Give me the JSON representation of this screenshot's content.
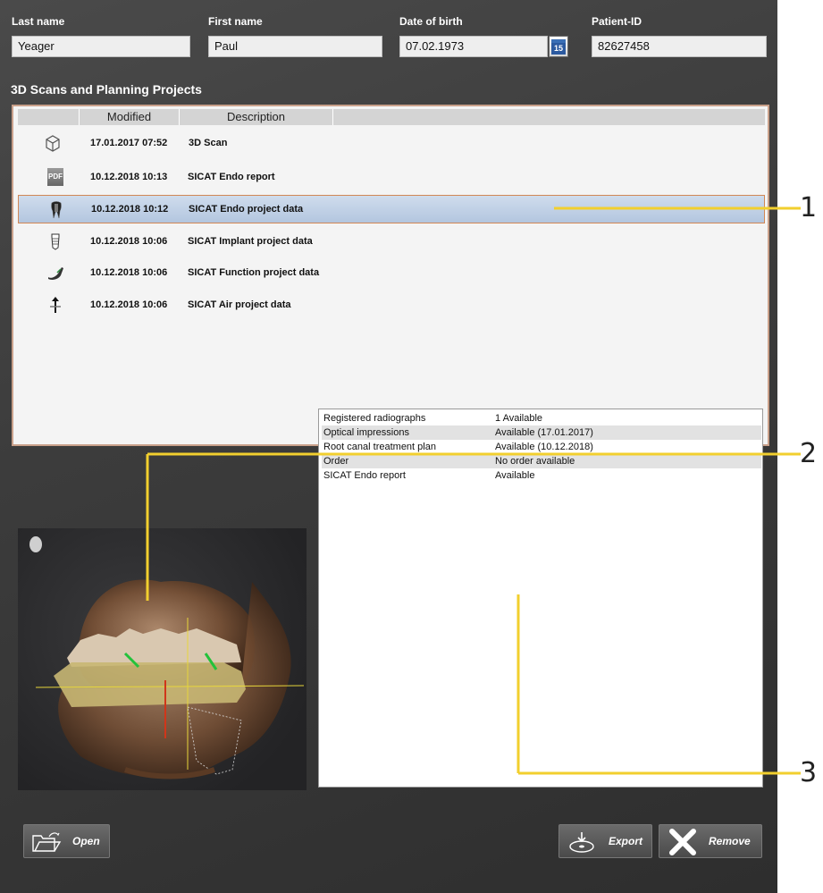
{
  "patient": {
    "last_name_label": "Last name",
    "last_name": "Yeager",
    "first_name_label": "First name",
    "first_name": "Paul",
    "dob_label": "Date of birth",
    "dob": "07.02.1973",
    "calendar_day": "15",
    "id_label": "Patient-ID",
    "id": "82627458"
  },
  "projects": {
    "title": "3D Scans and Planning Projects",
    "columns": [
      "Modified",
      "Description"
    ],
    "rows": [
      {
        "icon": "cube-icon",
        "modified": "17.01.2017 07:52",
        "description": "3D Scan"
      },
      {
        "icon": "pdf-icon",
        "icon_text": "PDF",
        "modified": "10.12.2018 10:13",
        "description": "SICAT Endo report"
      },
      {
        "icon": "tooth-icon",
        "modified": "10.12.2018 10:12",
        "description": "SICAT Endo project data",
        "selected": true
      },
      {
        "icon": "implant-icon",
        "modified": "10.12.2018 10:06",
        "description": "SICAT Implant project data"
      },
      {
        "icon": "jaw-icon",
        "modified": "10.12.2018 10:06",
        "description": "SICAT Function project data"
      },
      {
        "icon": "airway-icon",
        "modified": "10.12.2018 10:06",
        "description": "SICAT Air project data"
      }
    ]
  },
  "info": [
    {
      "key": "Registered radiographs",
      "value": "1 Available"
    },
    {
      "key": "Optical impressions",
      "value": "Available (17.01.2017)"
    },
    {
      "key": "Root canal treatment plan",
      "value": "Available (10.12.2018)"
    },
    {
      "key": "Order",
      "value": "No order available"
    },
    {
      "key": "SICAT Endo report",
      "value": "Available"
    }
  ],
  "buttons": {
    "open": "Open",
    "export": "Export",
    "remove": "Remove"
  },
  "callouts": [
    "1",
    "2",
    "3"
  ],
  "colors": {
    "callout_line": "#f2cf2e",
    "selection_border": "#d18755",
    "selection_fill": "#c2d3e8"
  }
}
